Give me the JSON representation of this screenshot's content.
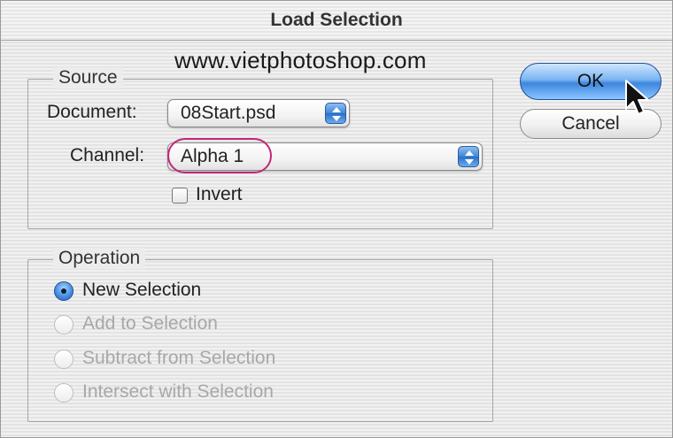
{
  "dialog": {
    "title": "Load Selection",
    "watermark": "www.vietphotoshop.com"
  },
  "source": {
    "legend": "Source",
    "document_label": "Document:",
    "document_value": "08Start.psd",
    "channel_label": "Channel:",
    "channel_value": "Alpha 1",
    "invert_label": "Invert",
    "invert_checked": false
  },
  "operation": {
    "legend": "Operation",
    "options": [
      {
        "label": "New Selection",
        "selected": true,
        "enabled": true
      },
      {
        "label": "Add to Selection",
        "selected": false,
        "enabled": false
      },
      {
        "label": "Subtract from Selection",
        "selected": false,
        "enabled": false
      },
      {
        "label": "Intersect with Selection",
        "selected": false,
        "enabled": false
      }
    ]
  },
  "buttons": {
    "ok_label": "OK",
    "cancel_label": "Cancel"
  },
  "colors": {
    "accent_blue": "#3d86de",
    "highlight_ring": "#c2267a",
    "disabled_text": "#a8a8a8"
  }
}
